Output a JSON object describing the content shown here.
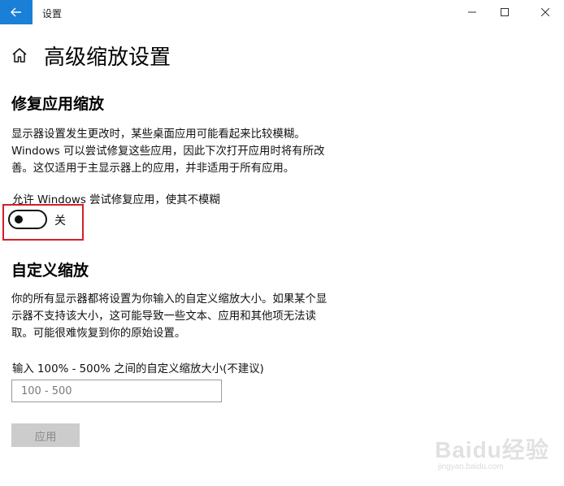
{
  "window": {
    "title": "设置"
  },
  "page": {
    "title": "高级缩放设置"
  },
  "fix_apps": {
    "heading": "修复应用缩放",
    "description": [
      "显示器设置发生更改时，某些桌面应用可能看起来比较模糊。",
      "Windows 可以尝试修复这些应用，因此下次打开应用时将有所改",
      "善。这仅适用于主显示器上的应用，并非适用于所有应用。"
    ],
    "toggle_label": "允许 Windows 尝试修复应用，使其不模糊",
    "toggle_state": "关",
    "toggle_on": false
  },
  "custom_scale": {
    "heading": "自定义缩放",
    "description": [
      "你的所有显示器都将设置为你输入的自定义缩放大小。如果某个显",
      "示器不支持该大小，这可能导致一些文本、应用和其他项无法读",
      "取。可能很难恢复到你的原始设置。"
    ],
    "input_label": "输入 100% - 500% 之间的自定义缩放大小(不建议)",
    "input_placeholder": "100 - 500",
    "input_value": "",
    "apply_label": "应用"
  },
  "watermark": {
    "text": "Baidu经验",
    "url": "jingyan.baidu.com"
  },
  "colors": {
    "accent": "#1a7fd6",
    "highlight": "#d21f2b",
    "button_disabled_bg": "#cccccc"
  }
}
